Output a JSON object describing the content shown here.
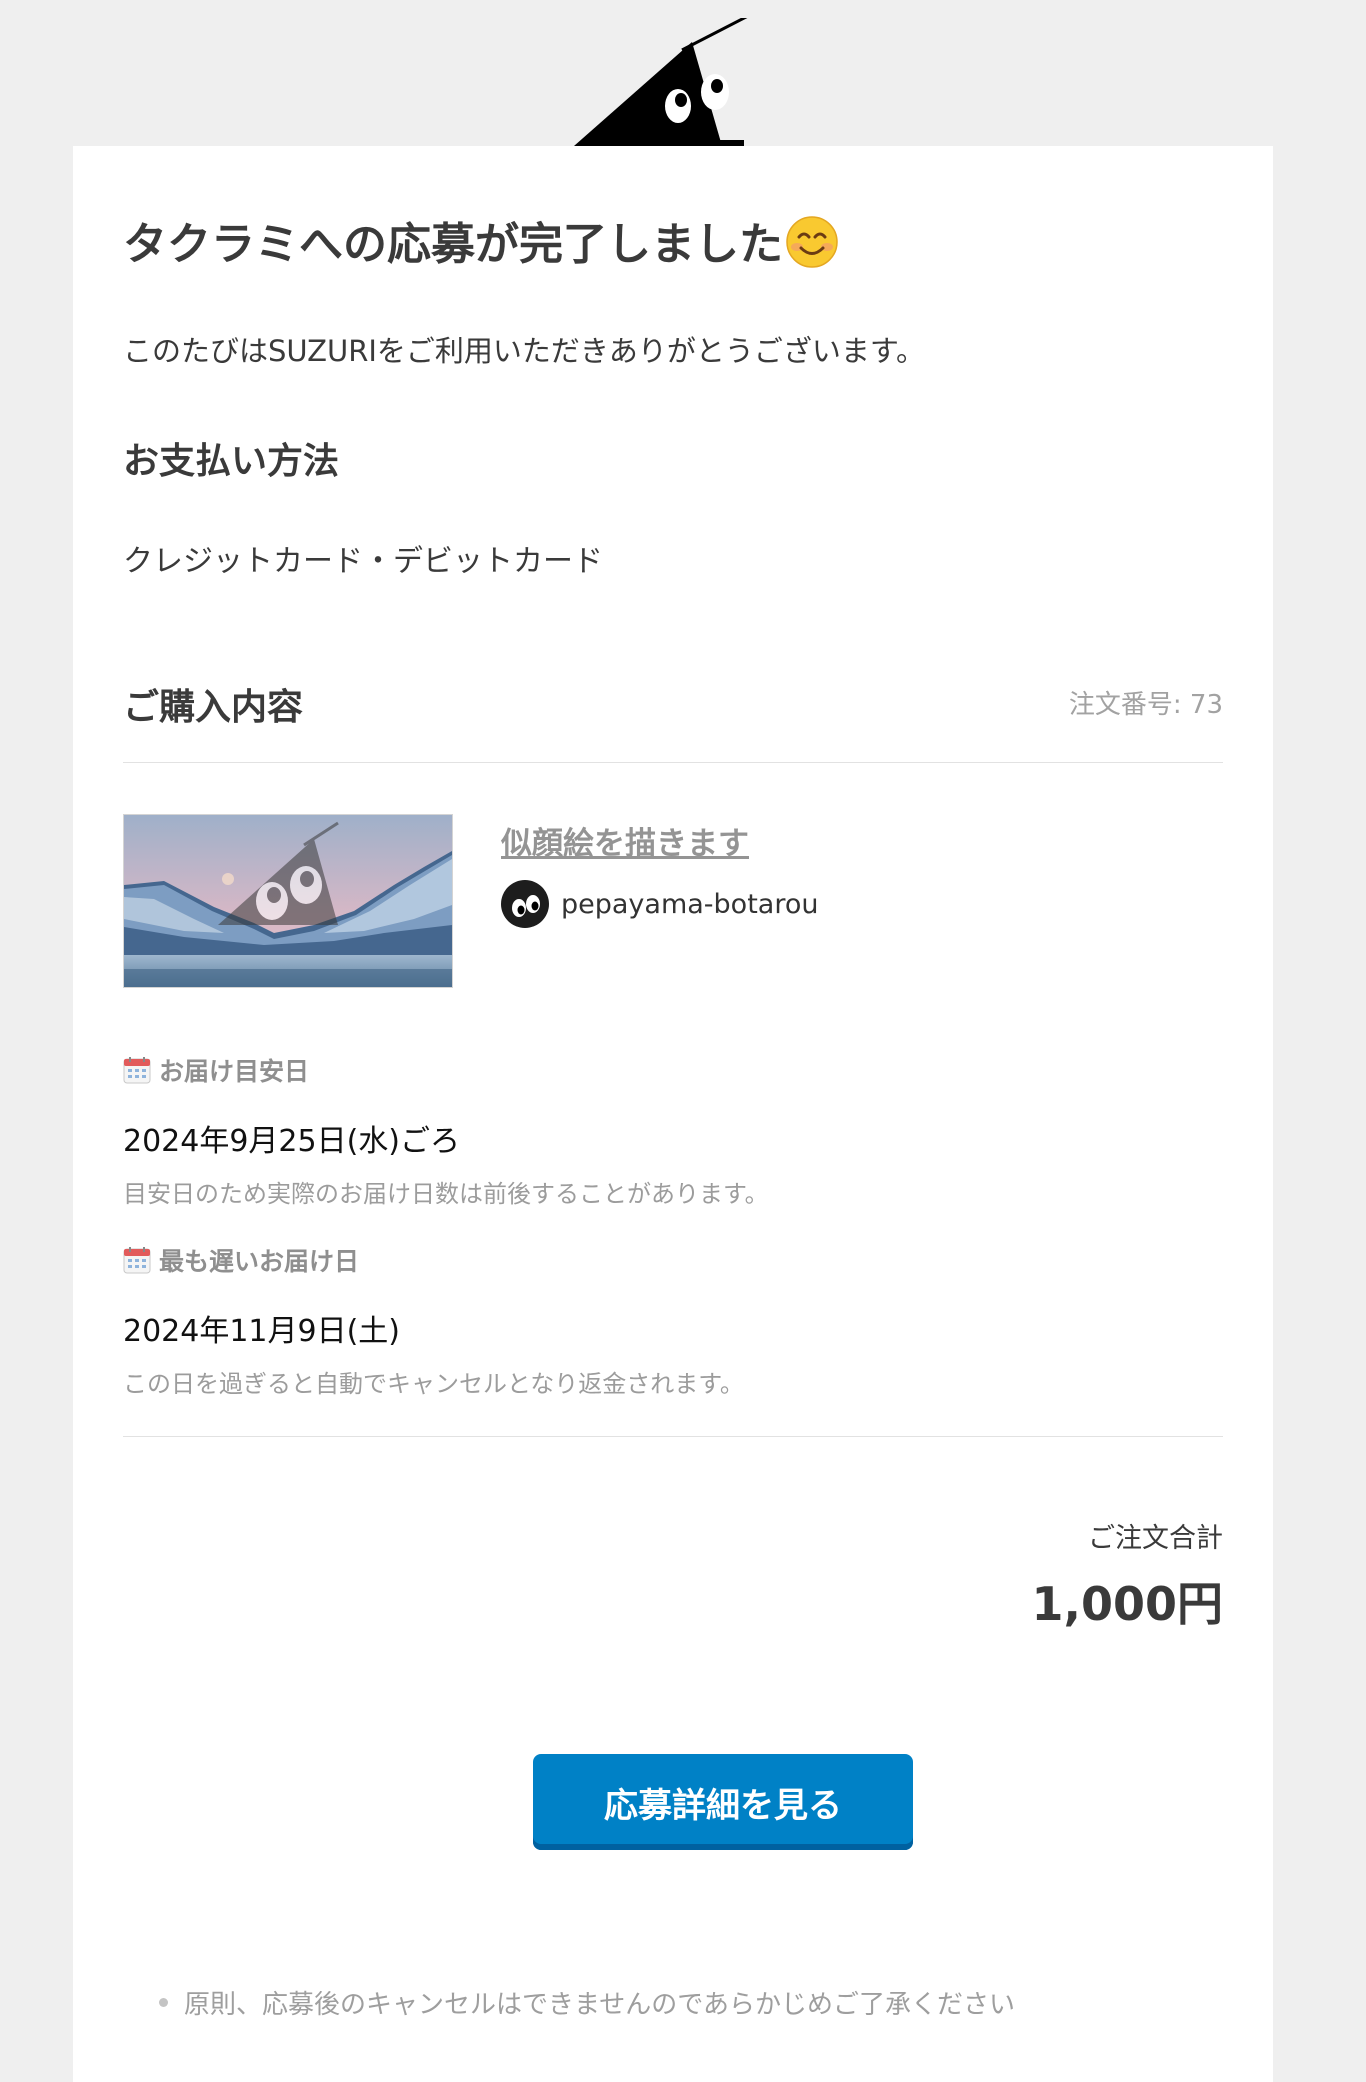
{
  "header": {
    "logo_icon": "suzuri-mascot-icon"
  },
  "message": {
    "title": "タクラミへの応募が完了しました",
    "title_emoji_icon": "smiling-face-icon",
    "thanks": "このたびはSUZURIをご利用いただきありがとうございます。"
  },
  "payment": {
    "heading": "お支払い方法",
    "method": "クレジットカード・デビットカード"
  },
  "purchase": {
    "heading": "ご購入内容",
    "order_number": "注文番号: 73",
    "item": {
      "title": "似顔絵を描きます",
      "creator": "pepayama-botarou"
    },
    "delivery_estimate": {
      "label": "お届け目安日",
      "date": "2024年9月25日(水)ごろ",
      "note": "目安日のため実際のお届け日数は前後することがあります。"
    },
    "latest_delivery": {
      "label": "最も遅いお届け日",
      "date": "2024年11月9日(土)",
      "note": "この日を過ぎると自動でキャンセルとなり返金されます。"
    }
  },
  "total": {
    "label": "ご注文合計",
    "amount": "1,000円"
  },
  "cta": {
    "label": "応募詳細を見る",
    "color": "#0081c6"
  },
  "footnote": {
    "text": "原則、応募後のキャンセルはできませんのであらかじめご了承ください"
  }
}
